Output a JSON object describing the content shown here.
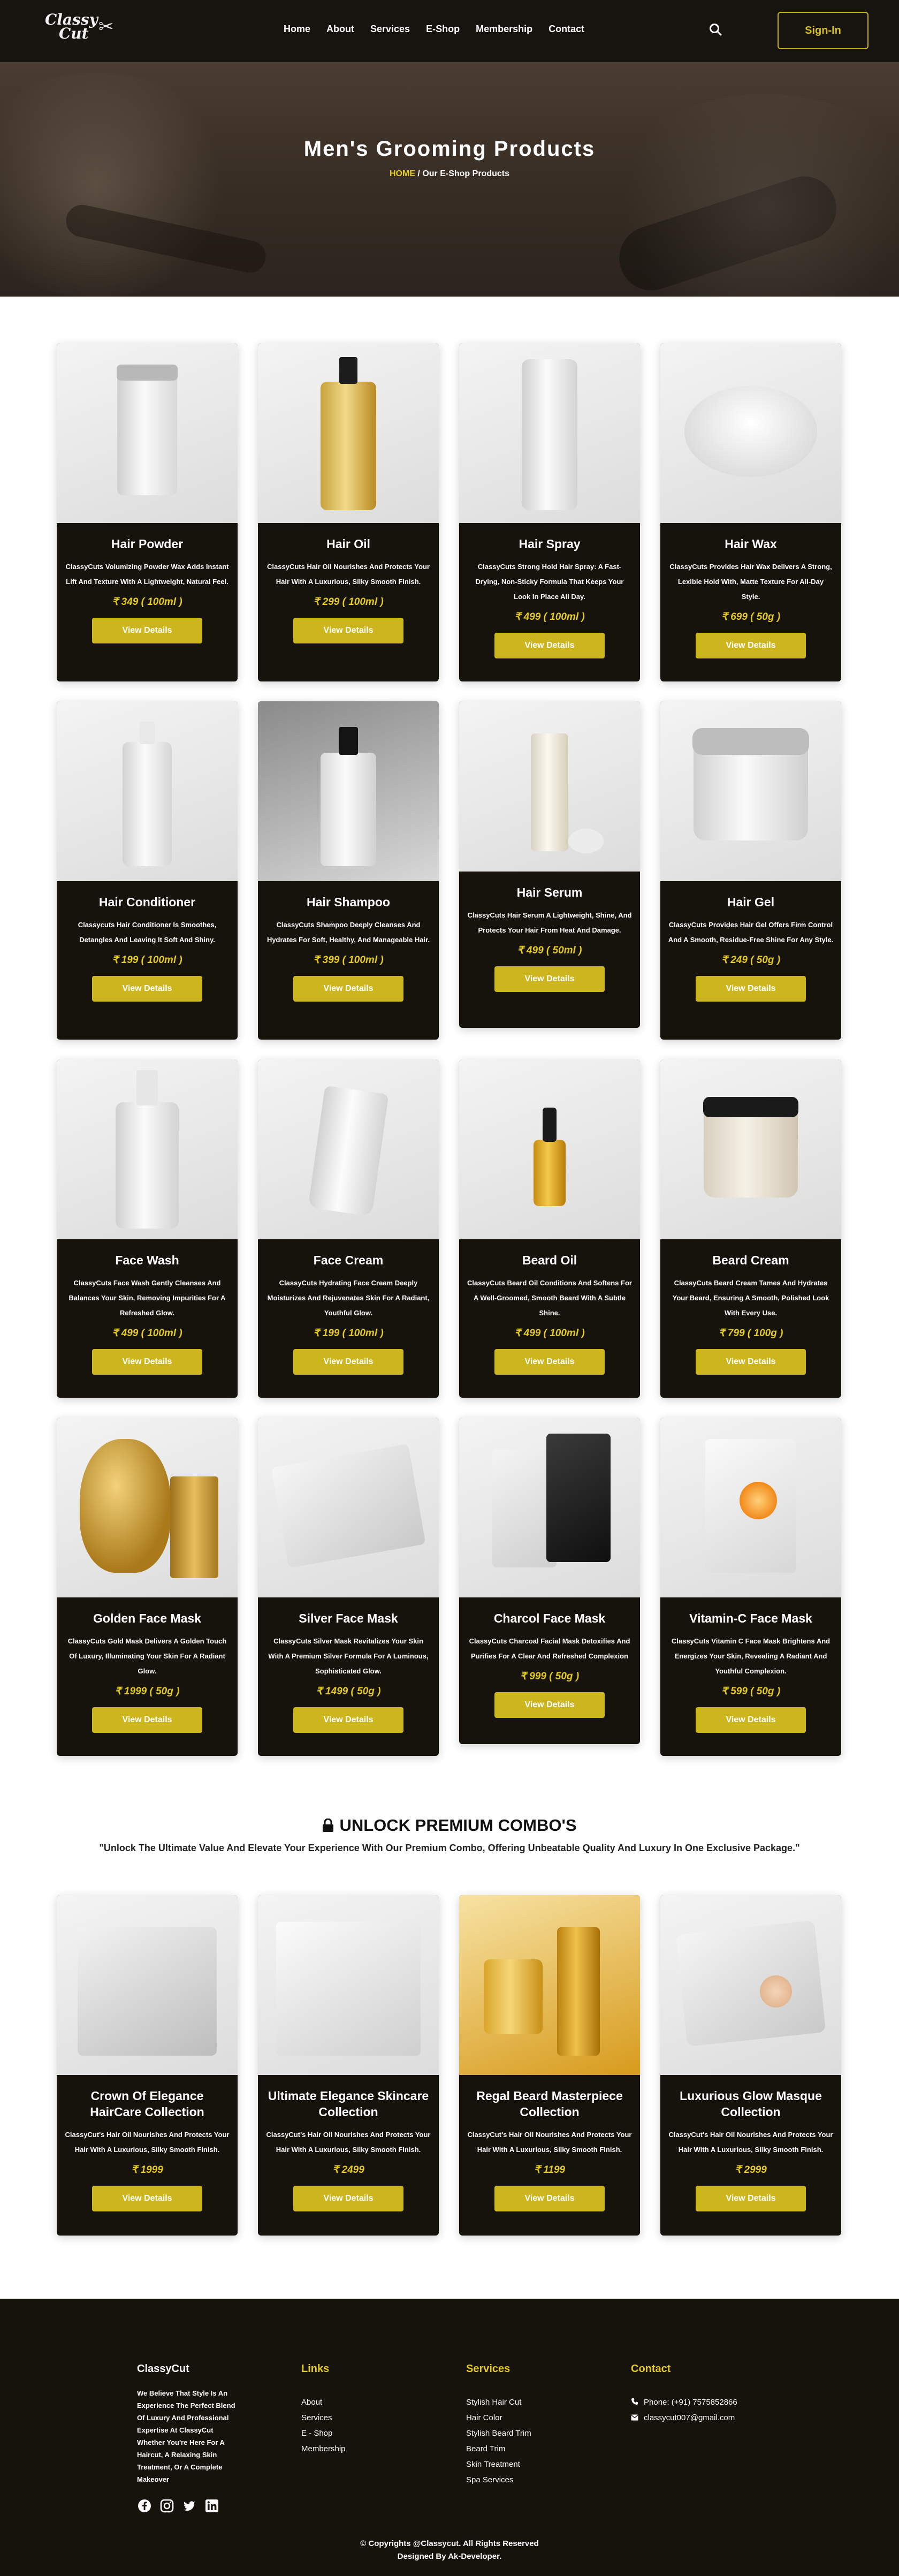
{
  "brand": {
    "logo_line1": "Classy",
    "logo_line2": "Cut"
  },
  "nav": {
    "items": [
      "Home",
      "About",
      "Services",
      "E-Shop",
      "Membership",
      "Contact"
    ],
    "signin": "Sign-In"
  },
  "hero": {
    "title": "Men's Grooming Products",
    "crumb_home": "HOME",
    "crumb_rest": " / Our E-Shop Products"
  },
  "cta": "View Details",
  "products": [
    {
      "title": "Hair Powder",
      "desc": "ClassyCuts Volumizing Powder Wax Adds Instant Lift And Texture With A Lightweight, Natural Feel.",
      "price": "₹ 349 ( 100ml )"
    },
    {
      "title": "Hair Oil",
      "desc": "ClassyCuts Hair Oil Nourishes And Protects Your Hair With A Luxurious, Silky Smooth Finish.",
      "price": "₹ 299 ( 100ml )"
    },
    {
      "title": "Hair Spray",
      "desc": "ClassyCuts Strong Hold Hair Spray: A Fast-Drying, Non-Sticky Formula That Keeps Your Look In Place All Day.",
      "price": "₹ 499 ( 100ml )"
    },
    {
      "title": "Hair Wax",
      "desc": "ClassyCuts Provides Hair Wax Delivers A Strong, Lexible Hold With, Matte Texture For All-Day Style.",
      "price": "₹ 699 ( 50g )"
    },
    {
      "title": "Hair Conditioner",
      "desc": "Classycuts Hair Conditioner Is Smoothes, Detangles And Leaving It Soft And Shiny.",
      "price": "₹ 199 ( 100ml )"
    },
    {
      "title": "Hair Shampoo",
      "desc": "ClassyCuts Shampoo Deeply Cleanses And Hydrates For Soft, Healthy, And Manageable Hair.",
      "price": "₹ 399 ( 100ml )"
    },
    {
      "title": "Hair Serum",
      "desc": "ClassyCuts Hair Serum A Lightweight, Shine, And Protects Your Hair From Heat And Damage.",
      "price": "₹ 499 ( 50ml )"
    },
    {
      "title": "Hair Gel",
      "desc": "ClassyCuts Provides Hair Gel Offers Firm Control And A Smooth, Residue-Free Shine For Any Style.",
      "price": "₹ 249 ( 50g )"
    },
    {
      "title": "Face Wash",
      "desc": "ClassyCuts Face Wash Gently Cleanses And Balances Your Skin, Removing Impurities For A Refreshed Glow.",
      "price": "₹ 499 ( 100ml )"
    },
    {
      "title": "Face Cream",
      "desc": "ClassyCuts Hydrating Face Cream Deeply Moisturizes And Rejuvenates Skin For A Radiant, Youthful Glow.",
      "price": "₹ 199 ( 100ml )"
    },
    {
      "title": "Beard Oil",
      "desc": "ClassyCuts Beard Oil Conditions And Softens For A Well-Groomed, Smooth Beard With A Subtle Shine.",
      "price": "₹ 499 ( 100ml )"
    },
    {
      "title": "Beard Cream",
      "desc": "ClassyCuts Beard Cream Tames And Hydrates Your Beard, Ensuring A Smooth, Polished Look With Every Use.",
      "price": "₹ 799 ( 100g )"
    },
    {
      "title": "Golden Face Mask",
      "desc": "ClassyCuts Gold Mask Delivers A Golden Touch Of Luxury, Illuminating Your Skin For A Radiant Glow.",
      "price": "₹ 1999 ( 50g )"
    },
    {
      "title": "Silver Face Mask",
      "desc": "ClassyCuts Silver Mask Revitalizes Your Skin With A Premium Silver Formula For A Luminous, Sophisticated Glow.",
      "price": "₹ 1499 ( 50g )"
    },
    {
      "title": "Charcol Face Mask",
      "desc": "ClassyCuts Charcoal Facial Mask Detoxifies And Purifies For A Clear And Refreshed Complexion",
      "price": "₹ 999 ( 50g )"
    },
    {
      "title": "Vitamin-C Face Mask",
      "desc": "ClassyCuts Vitamin C Face Mask Brightens And Energizes Your Skin, Revealing A Radiant And Youthful Complexion.",
      "price": "₹ 599 ( 50g )"
    }
  ],
  "combo": {
    "title": "UNLOCK PREMIUM COMBO'S",
    "subtitle": "\"Unlock The Ultimate Value And Elevate Your Experience With Our Premium Combo, Offering Unbeatable Quality And Luxury In One Exclusive Package.\"",
    "items": [
      {
        "title": "Crown Of Elegance HairCare Collection",
        "desc": "ClassyCut's Hair Oil Nourishes And Protects Your Hair With A Luxurious, Silky Smooth Finish.",
        "price": "₹ 1999"
      },
      {
        "title": "Ultimate Elegance Skincare Collection",
        "desc": "ClassyCut's Hair Oil Nourishes And Protects Your Hair With A Luxurious, Silky Smooth Finish.",
        "price": "₹ 2499"
      },
      {
        "title": "Regal Beard Masterpiece Collection",
        "desc": "ClassyCut's Hair Oil Nourishes And Protects Your Hair With A Luxurious, Silky Smooth Finish.",
        "price": "₹ 1199"
      },
      {
        "title": "Luxurious Glow Masque Collection",
        "desc": "ClassyCut's Hair Oil Nourishes And Protects Your Hair With A Luxurious, Silky Smooth Finish.",
        "price": "₹ 2999"
      }
    ]
  },
  "footer": {
    "brand": "ClassyCut",
    "about": "We Believe That Style Is An Experience The Perfect Blend Of Luxury And Professional Expertise At ClassyCut Whether You're Here For A Haircut, A Relaxing Skin Treatment, Or A Complete Makeover",
    "links_head": "Links",
    "links": [
      "About",
      "Services",
      "E - Shop",
      "Membership"
    ],
    "services_head": "Services",
    "services": [
      "Stylish Hair Cut",
      "Hair Color",
      "Stylish Beard Trim",
      "Beard Trim",
      "Skin Treatment",
      "Spa Services"
    ],
    "contact_head": "Contact",
    "phone": "Phone: (+91) 7575852866",
    "email": "classycut007@gmail.com",
    "copyright": "© Copyrights @Classycut. All Rights Reserved",
    "designed": "Designed By Ak-Developer."
  },
  "colors": {
    "accent": "#cdb51d",
    "dark": "#16130d",
    "price": "#e4cb1e"
  }
}
